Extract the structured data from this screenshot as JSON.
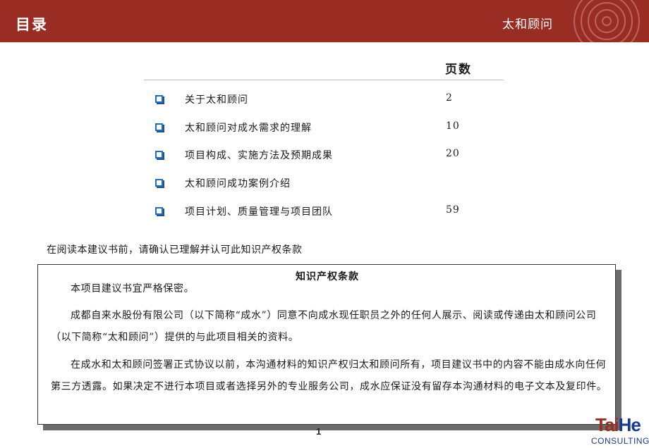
{
  "header": {
    "title": "目录",
    "brand": "太和顾问"
  },
  "toc": {
    "page_column_header": "页数",
    "items": [
      {
        "label": "关于太和顾问",
        "page": "2"
      },
      {
        "label": "太和顾问对成水需求的理解",
        "page": "10"
      },
      {
        "label": "项目构成、实施方法及预期成果",
        "page": "20"
      },
      {
        "label": "太和顾问成功案例介绍",
        "page": ""
      },
      {
        "label": "项目计划、质量管理与项目团队",
        "page": "59"
      }
    ]
  },
  "notice": "在阅读本建议书前，请确认已理解并认可此知识产权条款",
  "ip_terms": {
    "title": "知识产权条款",
    "paragraphs": [
      "本项目建议书宜严格保密。",
      "成都自来水股份有限公司（以下简称“成水”）同意不向成水现任职员之外的任何人展示、阅读或传递由太和顾问公司（以下简称“太和顾问”）提供的与此项目相关的资料。",
      "在成水和太和顾问签署正式协议以前，本沟通材料的知识产权归太和顾问所有，项目建议书中的内容不能由成水向任何第三方透露。如果决定不进行本项目或者选择另外的专业服务公司，成水应保证没有留存本沟通材料的电子文本及复印件。"
    ]
  },
  "footer": {
    "page_number": "1",
    "logo_text_a": "Tai",
    "logo_text_b": "He",
    "logo_sub": "CONSULTING"
  },
  "colors": {
    "header_bg": "#9a2d23",
    "bullet": "#1f6fbf"
  }
}
